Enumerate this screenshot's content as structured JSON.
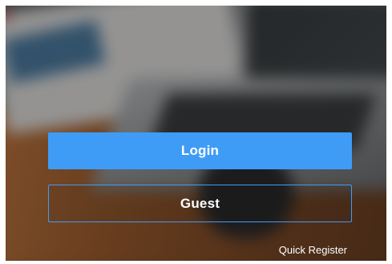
{
  "login_screen": {
    "login_label": "Login",
    "guest_label": "Guest",
    "quick_register_label": "Quick Register"
  },
  "colors": {
    "accent": "#3f9cf6",
    "text": "#ffffff"
  }
}
